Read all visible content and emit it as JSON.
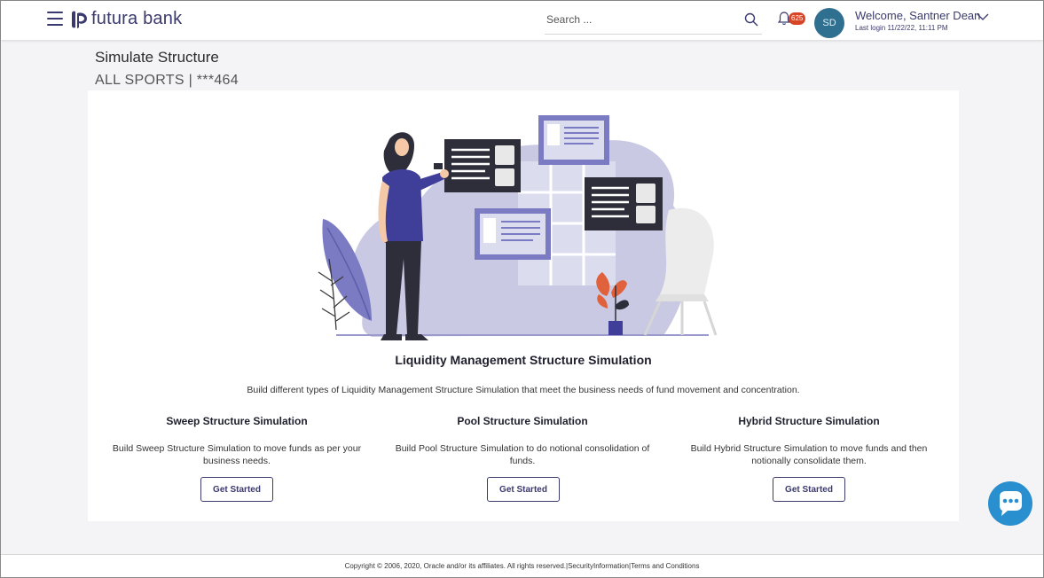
{
  "header": {
    "logo_text": "futura bank",
    "search_placeholder": "Search ...",
    "notification_count": "625",
    "avatar_initials": "SD",
    "welcome_text": "Welcome, Santner Dean",
    "last_login": "Last login 11/22/22, 11:11 PM"
  },
  "page": {
    "title": "Simulate Structure",
    "subtitle": "ALL SPORTS | ***464"
  },
  "content": {
    "heading": "Liquidity Management Structure Simulation",
    "description": "Build different types of Liquidity Management Structure Simulation that meet the business needs of fund movement and concentration.",
    "options": [
      {
        "title": "Sweep Structure Simulation",
        "description": "Build Sweep Structure Simulation to move funds as per your business needs.",
        "button": "Get Started"
      },
      {
        "title": "Pool Structure Simulation",
        "description": "Build Pool Structure Simulation to do notional consolidation of funds.",
        "button": "Get Started"
      },
      {
        "title": "Hybrid Structure Simulation",
        "description": "Build Hybrid Structure Simulation to move funds and then notionally consolidate them.",
        "button": "Get Started"
      }
    ]
  },
  "footer": {
    "text": "Copyright © 2006, 2020, Oracle and/or its affiliates. All rights reserved.|SecurityInformation|Terms and Conditions"
  },
  "colors": {
    "brand": "#3a3a6e",
    "badge": "#d64525",
    "avatar": "#2f6f8f",
    "chat": "#2a8fcf",
    "illustration_accent": "#7b7bc4"
  },
  "icons": {
    "menu": "hamburger-menu-icon",
    "search": "search-icon",
    "notifications": "bell-icon",
    "profile_menu": "chevron-down-icon",
    "chat": "chat-bubble-icon"
  }
}
